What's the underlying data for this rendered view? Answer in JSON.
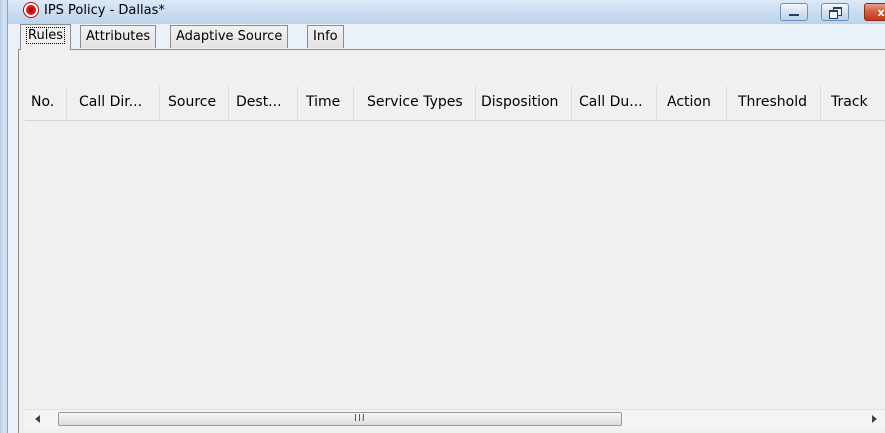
{
  "window": {
    "title": "IPS Policy - Dallas*",
    "controls": {
      "minimize": "minimize-icon",
      "maximize": "restore-icon",
      "close": "close-icon"
    },
    "close_glyph": "x"
  },
  "tabs": [
    {
      "label": "Rules",
      "active": true
    },
    {
      "label": "Attributes",
      "active": false
    },
    {
      "label": "Adaptive Source",
      "active": false
    },
    {
      "label": "Info",
      "active": false
    }
  ],
  "table": {
    "columns": [
      "No.",
      "Call Dir...",
      "Source",
      "Dest...",
      "Time",
      "Service Types",
      "Disposition",
      "Call Du...",
      "Action",
      "Threshold",
      "Track"
    ],
    "rows": []
  },
  "scrollbar": {
    "grip": "III"
  },
  "colors": {
    "accent": "#c9dcef",
    "close": "#c13b1d",
    "app_icon": "#d21b1b"
  }
}
